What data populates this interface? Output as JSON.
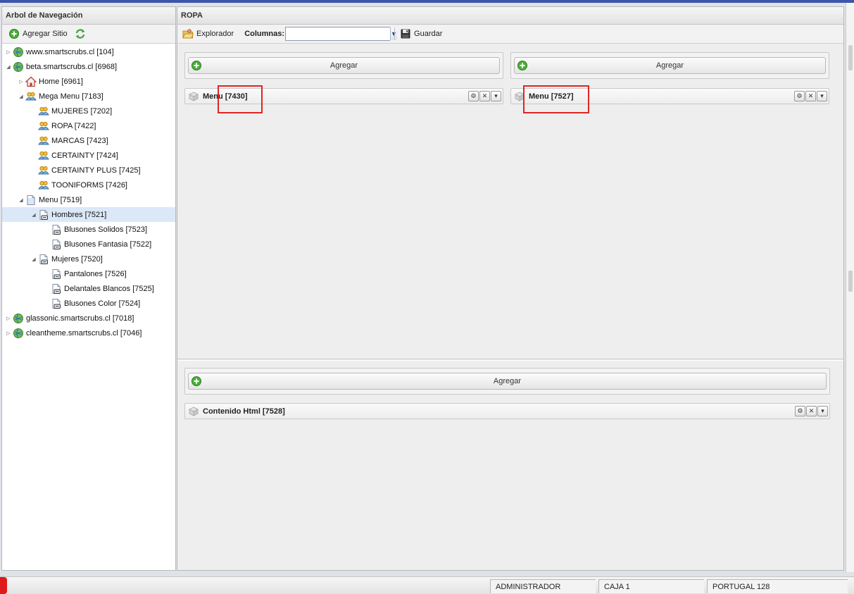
{
  "left_panel": {
    "title": "Arbol de Navegación",
    "toolbar": {
      "add_site_label": "Agregar Sitio"
    },
    "tree": [
      {
        "label": "www.smartscrubs.cl [104]",
        "level": 0,
        "expander": "collapsed",
        "icon": "globe-icon"
      },
      {
        "label": "beta.smartscrubs.cl [6968]",
        "level": 0,
        "expander": "expanded",
        "icon": "globe-icon"
      },
      {
        "label": "Home [6961]",
        "level": 1,
        "expander": "collapsed",
        "icon": "home-icon"
      },
      {
        "label": "Mega Menu [7183]",
        "level": 1,
        "expander": "expanded",
        "icon": "user-group-icon"
      },
      {
        "label": "MUJERES [7202]",
        "level": 2,
        "expander": "none",
        "icon": "user-group-icon"
      },
      {
        "label": "ROPA [7422]",
        "level": 2,
        "expander": "none",
        "icon": "user-group-icon"
      },
      {
        "label": "MARCAS [7423]",
        "level": 2,
        "expander": "none",
        "icon": "user-group-icon"
      },
      {
        "label": "CERTAINTY [7424]",
        "level": 2,
        "expander": "none",
        "icon": "user-group-icon"
      },
      {
        "label": "CERTAINTY PLUS [7425]",
        "level": 2,
        "expander": "none",
        "icon": "user-group-icon"
      },
      {
        "label": "TOONIFORMS [7426]",
        "level": 2,
        "expander": "none",
        "icon": "user-group-icon"
      },
      {
        "label": "Menu [7519]",
        "level": 1,
        "expander": "expanded",
        "icon": "page-icon"
      },
      {
        "label": "Hombres [7521]",
        "level": 2,
        "expander": "expanded",
        "icon": "link-page-icon",
        "selected": true
      },
      {
        "label": "Blusones Solidos [7523]",
        "level": 3,
        "expander": "none",
        "icon": "link-page-icon"
      },
      {
        "label": "Blusones Fantasia [7522]",
        "level": 3,
        "expander": "none",
        "icon": "link-page-icon"
      },
      {
        "label": "Mujeres [7520]",
        "level": 2,
        "expander": "expanded",
        "icon": "link-page-icon"
      },
      {
        "label": "Pantalones [7526]",
        "level": 3,
        "expander": "none",
        "icon": "link-page-icon"
      },
      {
        "label": "Delantales Blancos [7525]",
        "level": 3,
        "expander": "none",
        "icon": "link-page-icon"
      },
      {
        "label": "Blusones Color [7524]",
        "level": 3,
        "expander": "none",
        "icon": "link-page-icon"
      },
      {
        "label": "glassonic.smartscrubs.cl [7018]",
        "level": 0,
        "expander": "collapsed",
        "icon": "globe-icon"
      },
      {
        "label": "cleantheme.smartscrubs.cl [7046]",
        "level": 0,
        "expander": "collapsed",
        "icon": "globe-icon"
      }
    ]
  },
  "right_panel": {
    "title": "ROPA",
    "toolbar": {
      "explorer_label": "Explorador",
      "columns_label": "Columnas:",
      "columns_value": "",
      "save_label": "Guardar"
    },
    "add_label": "Agregar",
    "widgets": {
      "top_left": "Menu [7430]",
      "top_right": "Menu [7527]",
      "bottom": "Contenido Html [7528]"
    }
  },
  "status_bar": {
    "user": "ADMINISTRADOR",
    "register": "CAJA 1",
    "location": "PORTUGAL 128"
  },
  "colors": {
    "highlight": "#e02424",
    "selected_row": "#dbe8f7",
    "accent_green": "#3fa33f"
  }
}
